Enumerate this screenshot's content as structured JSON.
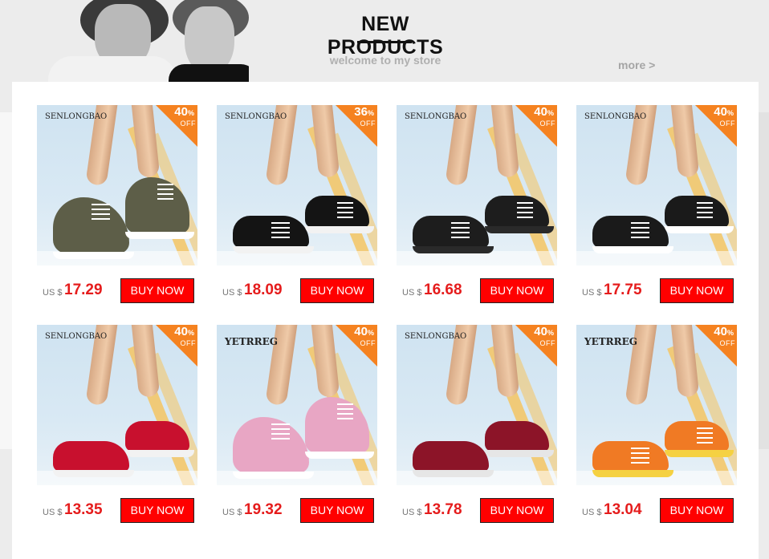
{
  "header": {
    "title": "NEW PRODUCTS",
    "subtitle": "welcome to my store",
    "more_link": "more >"
  },
  "colors": {
    "badge": "#f58220",
    "buy_button": "#ff0000",
    "price": "#e51c1c",
    "panel": "#ffffff",
    "page_bg": "#ececec"
  },
  "products": [
    {
      "brand": "SENLONGBAO",
      "discount": "40",
      "pct_sign": "%",
      "off": "OFF",
      "currency": "US $",
      "price": "17.29",
      "buy_label": "BUY NOW",
      "shoe_color": "#5d5e48",
      "sole_color": "#ffffff",
      "style": "high-top"
    },
    {
      "brand": "SENLONGBAO",
      "discount": "36",
      "pct_sign": "%",
      "off": "OFF",
      "currency": "US $",
      "price": "18.09",
      "buy_label": "BUY NOW",
      "shoe_color": "#141414",
      "sole_color": "#f2f2f2",
      "style": "sneaker"
    },
    {
      "brand": "SENLONGBAO",
      "discount": "40",
      "pct_sign": "%",
      "off": "OFF",
      "currency": "US $",
      "price": "16.68",
      "buy_label": "BUY NOW",
      "shoe_color": "#1d1d1d",
      "sole_color": "#2a2a2a",
      "style": "sneaker"
    },
    {
      "brand": "SENLONGBAO",
      "discount": "40",
      "pct_sign": "%",
      "off": "OFF",
      "currency": "US $",
      "price": "17.75",
      "buy_label": "BUY NOW",
      "shoe_color": "#1a1a1a",
      "sole_color": "#ffffff",
      "style": "sneaker"
    },
    {
      "brand": "SENLONGBAO",
      "discount": "40",
      "pct_sign": "%",
      "off": "OFF",
      "currency": "US $",
      "price": "13.35",
      "buy_label": "BUY NOW",
      "shoe_color": "#c8102e",
      "sole_color": "#f2f2f2",
      "style": "slip-on"
    },
    {
      "brand": "YETRREG",
      "discount": "40",
      "pct_sign": "%",
      "off": "OFF",
      "currency": "US $",
      "price": "19.32",
      "buy_label": "BUY NOW",
      "shoe_color": "#e8a6c4",
      "sole_color": "#ffffff",
      "style": "high-top"
    },
    {
      "brand": "SENLONGBAO",
      "discount": "40",
      "pct_sign": "%",
      "off": "OFF",
      "currency": "US $",
      "price": "13.78",
      "buy_label": "BUY NOW",
      "shoe_color": "#8c1428",
      "sole_color": "#e6e6e6",
      "style": "mary-jane"
    },
    {
      "brand": "YETRREG",
      "discount": "40",
      "pct_sign": "%",
      "off": "OFF",
      "currency": "US $",
      "price": "13.04",
      "buy_label": "BUY NOW",
      "shoe_color": "#f07a24",
      "sole_color": "#f5d142",
      "style": "oxford"
    }
  ]
}
